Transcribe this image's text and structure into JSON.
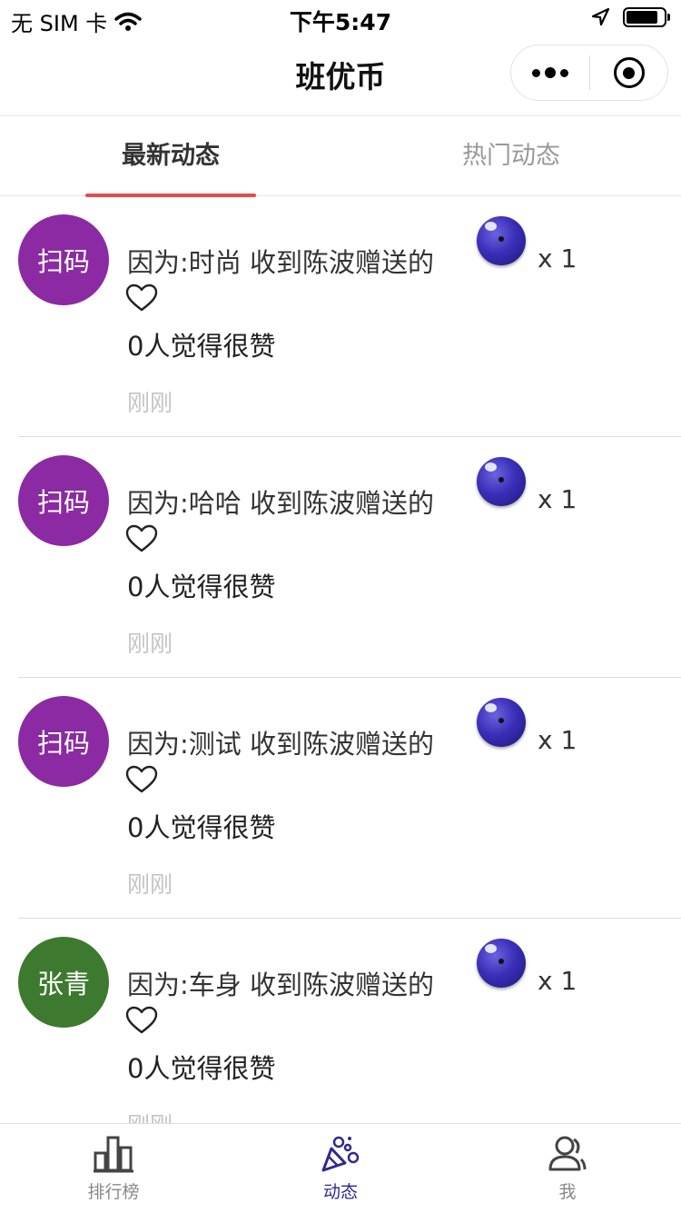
{
  "status_bar": {
    "carrier": "无 SIM 卡",
    "time": "下午5:47",
    "battery_level": 0.85
  },
  "nav": {
    "title": "班优币"
  },
  "tabs": [
    {
      "label": "最新动态",
      "active": true
    },
    {
      "label": "热门动态",
      "active": false
    }
  ],
  "feed": [
    {
      "avatar_text": "扫码",
      "avatar_color": "#8b2aa2",
      "reason": "因为:时尚 收到陈波赠送的",
      "count": "x 1",
      "likes": "0人觉得很赞",
      "time": "刚刚"
    },
    {
      "avatar_text": "扫码",
      "avatar_color": "#8b2aa2",
      "reason": "因为:哈哈 收到陈波赠送的",
      "count": "x 1",
      "likes": "0人觉得很赞",
      "time": "刚刚"
    },
    {
      "avatar_text": "扫码",
      "avatar_color": "#8b2aa2",
      "reason": "因为:测试 收到陈波赠送的",
      "count": "x 1",
      "likes": "0人觉得很赞",
      "time": "刚刚"
    },
    {
      "avatar_text": "张青",
      "avatar_color": "#3d7a2f",
      "reason": "因为:车身 收到陈波赠送的",
      "count": "x 1",
      "likes": "0人觉得很赞",
      "time": "刚刚"
    }
  ],
  "tab_bar": [
    {
      "label": "排行榜",
      "icon": "bar-chart-icon",
      "active": false
    },
    {
      "label": "动态",
      "icon": "party-popper-icon",
      "active": true
    },
    {
      "label": "我",
      "icon": "user-icon",
      "active": false
    }
  ],
  "colors": {
    "accent_underline": "#e54d4d",
    "active_tab_bar": "#2f2a8f",
    "inactive_tab_bar": "#888888",
    "time_text": "#c4c4c4"
  }
}
